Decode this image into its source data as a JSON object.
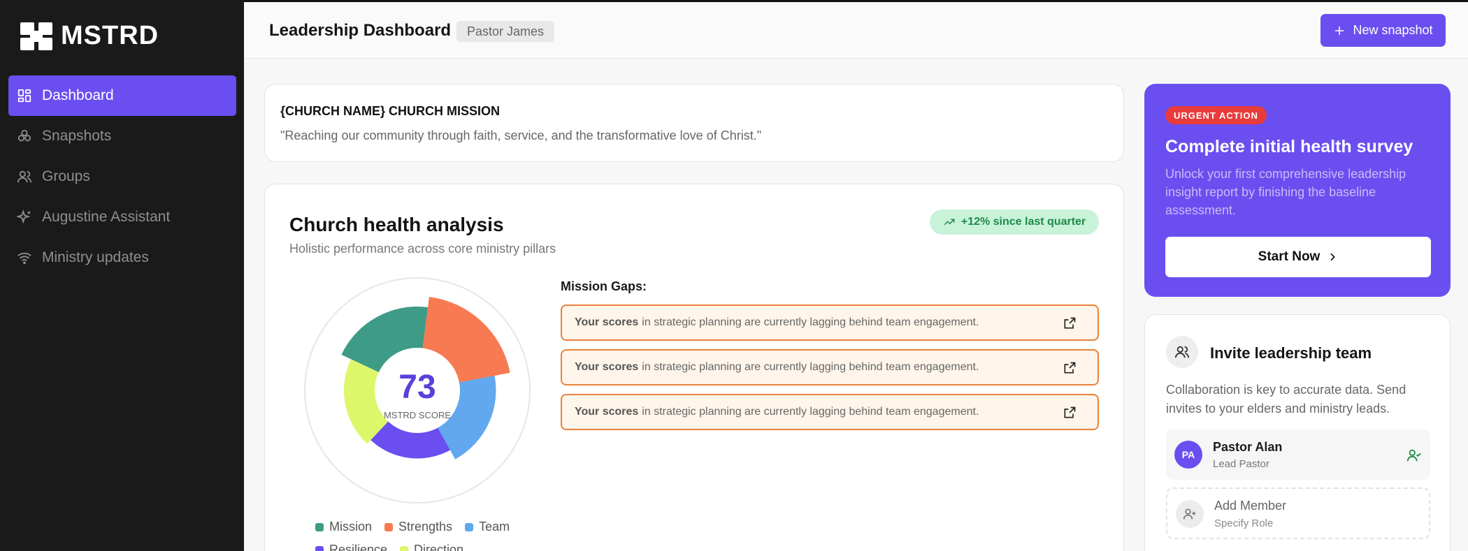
{
  "app": {
    "name": "MSTRD"
  },
  "sidebar": {
    "items": [
      {
        "label": "Dashboard",
        "icon": "dashboard-icon",
        "active": true
      },
      {
        "label": "Snapshots",
        "icon": "snapshots-icon",
        "active": false
      },
      {
        "label": "Groups",
        "icon": "users-icon",
        "active": false
      },
      {
        "label": "Augustine Assistant",
        "icon": "sparkles-icon",
        "active": false
      },
      {
        "label": "Ministry updates",
        "icon": "wifi-icon",
        "active": false
      }
    ]
  },
  "header": {
    "title": "Leadership Dashboard",
    "user": "Pastor James",
    "new_snapshot_label": "New snapshot"
  },
  "mission": {
    "title": "{CHURCH NAME} CHURCH MISSION",
    "text": "\"Reaching our community through faith, service, and the transformative love of Christ.\""
  },
  "health": {
    "title": "Church health analysis",
    "subtitle": "Holistic performance across core ministry pillars",
    "trend": "+12% since last quarter",
    "score": "73",
    "score_label": "MSTRD SCORE",
    "gaps_title": "Mission Gaps:",
    "gaps": [
      {
        "bold": "Your scores",
        "text": "in strategic planning are currently lagging behind team engagement."
      },
      {
        "bold": "Your scores",
        "text": "in strategic planning are currently lagging behind team engagement."
      },
      {
        "bold": "Your scores",
        "text": "in strategic planning are currently lagging behind team engagement."
      }
    ]
  },
  "chart_data": {
    "type": "pie",
    "title": "",
    "center_value": 73,
    "center_label": "MSTRD SCORE",
    "series": [
      {
        "name": "Mission",
        "value": 80,
        "color": "#3d9b86"
      },
      {
        "name": "Strengths",
        "value": 90,
        "color": "#f77a52"
      },
      {
        "name": "Team",
        "value": 75,
        "color": "#62a8ee"
      },
      {
        "name": "Resilience",
        "value": 65,
        "color": "#6b4ef0"
      },
      {
        "name": "Direction",
        "value": 70,
        "color": "#dcf76a"
      }
    ],
    "legend": [
      "Mission",
      "Strengths",
      "Team",
      "Resilience",
      "Direction"
    ],
    "legend_position": "bottom"
  },
  "urgent": {
    "badge": "URGENT ACTION",
    "title": "Complete initial health survey",
    "text": "Unlock your first comprehensive leadership insight report by finishing the baseline assessment.",
    "button": "Start Now"
  },
  "invite": {
    "title": "Invite leadership team",
    "text": "Collaboration is key to accurate data. Send invites to your elders and ministry leads.",
    "member": {
      "initials": "PA",
      "name": "Pastor Alan",
      "role": "Lead Pastor"
    },
    "add": {
      "name": "Add Member",
      "role": "Specify Role"
    }
  },
  "colors": {
    "accent": "#6b4ef0",
    "sidebar_bg": "#1a1a1a",
    "urgent": "#e83b3b",
    "success_bg": "#c9f3d9",
    "success_text": "#1f8a49",
    "gap_border": "#e8823d"
  }
}
